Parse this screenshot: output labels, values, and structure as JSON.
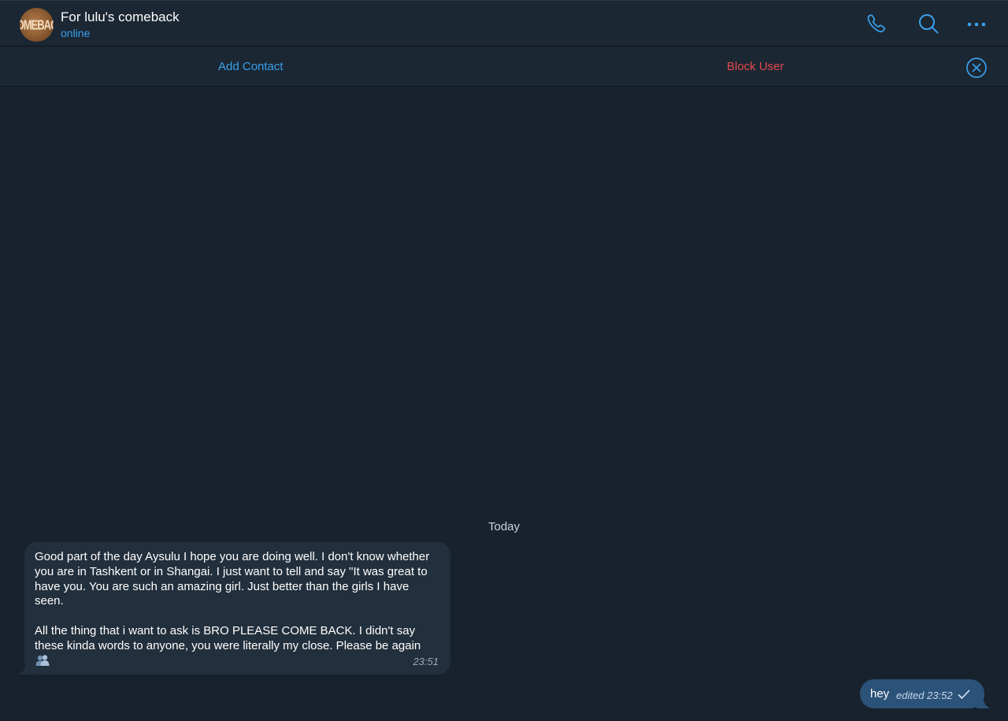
{
  "header": {
    "avatar_text": "COMEBACK",
    "title": "For lulu's comeback",
    "status": "online",
    "icons": [
      "phone-icon",
      "search-icon",
      "more-icon"
    ]
  },
  "actionbar": {
    "add_contact": "Add Contact",
    "block_user": "Block User",
    "close_icon": "close-circle-icon"
  },
  "chat": {
    "date_separator": "Today",
    "incoming": {
      "paragraph1": "Good part of the day Aysulu I hope you are doing well. I don't know whether you are in Tashkent or in Shangai. I just want to tell and say \"It was great to have you. You are such an amazing girl. Just better than the girls I have seen.",
      "paragraph2": "All the thing that i want to ask is BRO PLEASE COME BACK. I didn't say these kinda words to anyone, you were literally my close. Please be again",
      "emoji": "busts-in-silhouette-emoji",
      "time": "23:51"
    },
    "outgoing": {
      "text": "hey",
      "meta": "edited 23:52",
      "status_icon": "check-icon"
    }
  },
  "colors": {
    "background": "#18222d",
    "header": "#1b2733",
    "accent": "#3aa0ec",
    "danger": "#e5484d",
    "incoming_bubble": "#222f3c",
    "outgoing_bubble": "#2b5278"
  }
}
